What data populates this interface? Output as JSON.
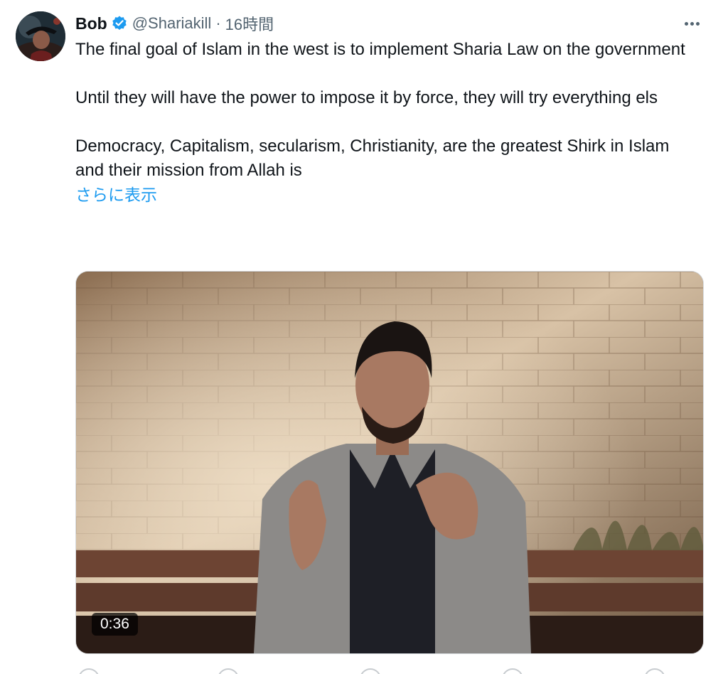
{
  "author": {
    "display_name": "Bob",
    "handle": "@Shariakill",
    "separator": "·",
    "time": "16時間",
    "verified": true
  },
  "icons": {
    "avatar": "avatar-image",
    "verified": "verified-badge-icon",
    "more": "more-options-icon"
  },
  "colors": {
    "accent": "#1d9bf0",
    "text": "#0f1419",
    "muted": "#536471"
  },
  "tweet": {
    "paragraphs": [
      "The final goal of Islam in the west is to implement Sharia Law on the government",
      "Until they will have the power to impose it by force, they will try everything els",
      "Democracy, Capitalism, secularism, Christianity, are the greatest Shirk in Islam and their mission from Allah is"
    ],
    "show_more": "さらに表示"
  },
  "media": {
    "type": "video",
    "duration": "0:36"
  }
}
